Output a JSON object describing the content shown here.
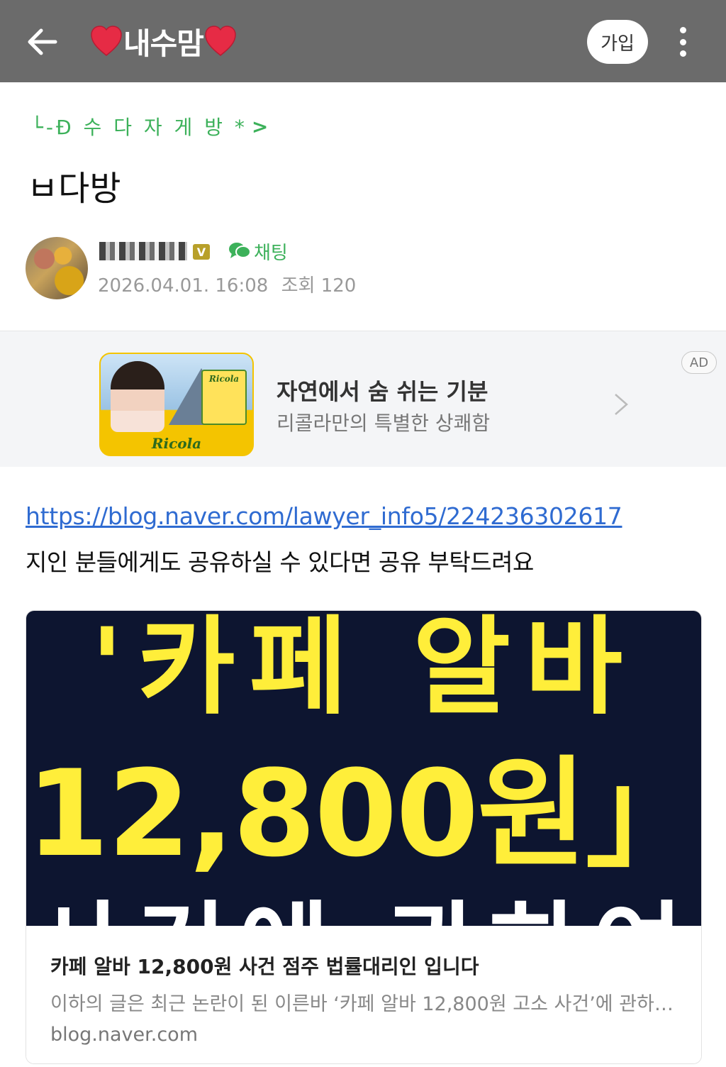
{
  "header": {
    "back_icon": "arrow-left-icon",
    "cafe_name": "내수맘",
    "heart_color": "#e62b45",
    "join_label": "가입",
    "more_icon": "vertical-dots-icon"
  },
  "board": {
    "name": "└-Đ 수 다 자 게 방 *",
    "chevron": ">"
  },
  "post": {
    "title": "ㅂ다방",
    "author": {
      "nickname": "",
      "verified_badge": "V",
      "chat_label": "채팅"
    },
    "date": "2026.04.01. 16:08",
    "views_label": "조회 120",
    "link": "https://blog.naver.com/lawyer_info5/224236302617",
    "body": "지인 분들에게도 공유하실 수 있다면 공유 부탁드려요"
  },
  "ad": {
    "badge": "AD",
    "title": "자연에서 숨 쉬는 기분",
    "subtitle": "리콜라만의 특별한 상쾌함",
    "image_logo": "Ricola",
    "accent": "#f4c400"
  },
  "link_card": {
    "thumb_line1": "'카페 알바",
    "thumb_line2": "12,800원」",
    "thumb_line3": "사건에 관하여",
    "title": "카페 알바 12,800원 사건 점주 법률대리인 입니다",
    "description": "이하의 글은 최근 논란이 된 이른바 ‘카페 알바 12,800원 고소 사건’에 관하여,...",
    "domain": "blog.naver.com"
  },
  "colors": {
    "topbar": "#6b6b6b",
    "green": "#3cb15a",
    "link": "#2f6bd1",
    "thumb_bg": "#0d1530",
    "thumb_text": "#ffee3a"
  }
}
